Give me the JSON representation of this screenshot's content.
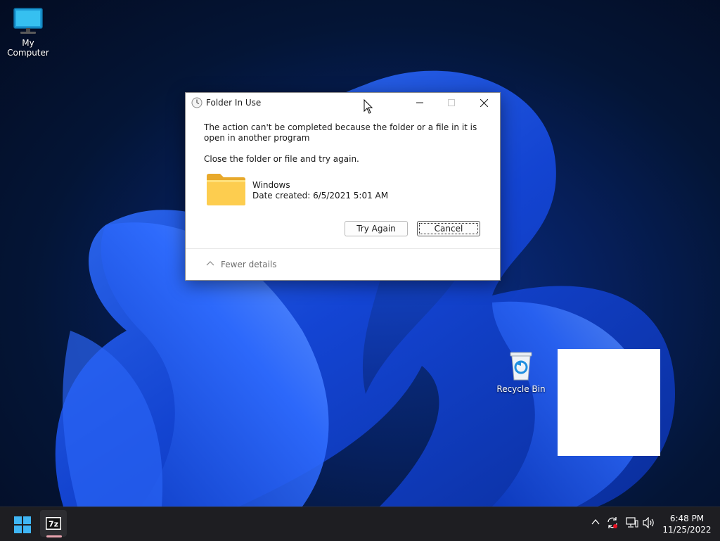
{
  "desktop": {
    "icons": [
      {
        "label": "My Computer",
        "icon": "computer-icon"
      },
      {
        "label": "Recycle Bin",
        "icon": "recycle-bin-icon"
      }
    ]
  },
  "dialog": {
    "title": "Folder In Use",
    "title_icon": "clock-icon",
    "message": "The action can't be completed because the folder or a file in it is open in another program",
    "instruction": "Close the folder or file and try again.",
    "item": {
      "name": "Windows",
      "date_created": "Date created: 6/5/2021 5:01 AM",
      "icon": "folder-icon"
    },
    "buttons": {
      "try_again": "Try Again",
      "cancel": "Cancel"
    },
    "details_toggle": "Fewer details"
  },
  "taskbar": {
    "apps": [
      {
        "label": "7z",
        "icon": "7zip-icon"
      }
    ],
    "clock": {
      "time": "6:48 PM",
      "date": "11/25/2022"
    }
  },
  "colors": {
    "desktop_bg": "#041536",
    "taskbar_bg": "#1e1e22",
    "accent": "#1a73e8"
  }
}
